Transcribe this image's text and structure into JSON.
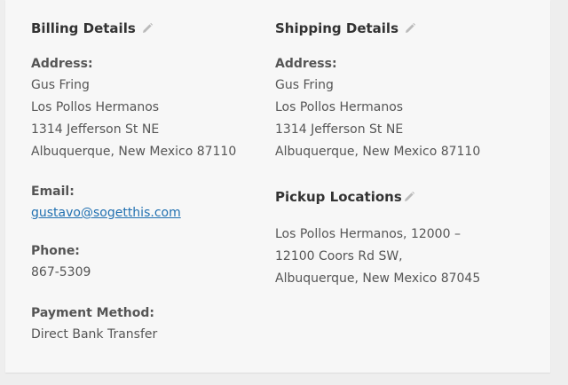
{
  "billing": {
    "title": "Billing Details",
    "address_label": "Address:",
    "address_lines": [
      "Gus Fring",
      "Los Pollos Hermanos",
      "1314 Jefferson St NE",
      "Albuquerque, New Mexico 87110"
    ],
    "email_label": "Email:",
    "email": "gustavo@sogetthis.com",
    "phone_label": "Phone:",
    "phone": "867-5309",
    "payment_label": "Payment Method:",
    "payment": "Direct Bank Transfer"
  },
  "shipping": {
    "title": "Shipping Details",
    "address_label": "Address:",
    "address_lines": [
      "Gus Fring",
      "Los Pollos Hermanos",
      "1314 Jefferson St NE",
      "Albuquerque, New Mexico 87110"
    ],
    "pickup_title": "Pickup Locations",
    "pickup_lines": [
      "Los Pollos Hermanos, 12000 –",
      "12100 Coors Rd SW,",
      "Albuquerque, New Mexico 87045"
    ]
  },
  "icons": {
    "edit": "pencil-icon"
  },
  "colors": {
    "link": "#2271b1",
    "icon": "#bbbbbb"
  }
}
